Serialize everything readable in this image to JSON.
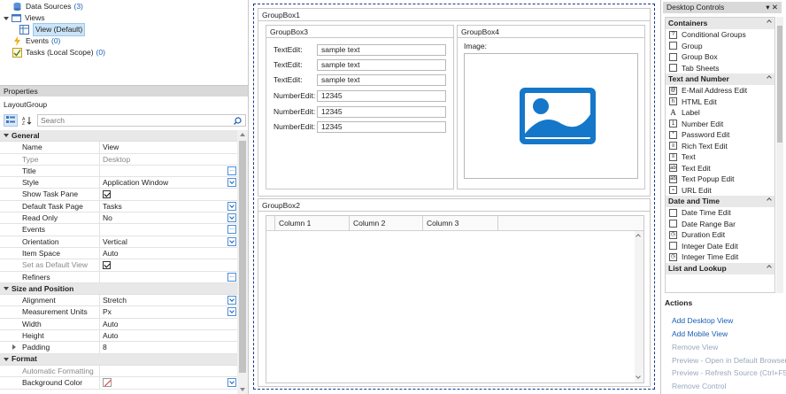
{
  "tree": {
    "items": [
      {
        "label": "Data Sources",
        "count": "(3)"
      },
      {
        "label": "Views",
        "count": ""
      },
      {
        "label": "View (Default)",
        "count": ""
      },
      {
        "label": "Events",
        "count": "(0)"
      },
      {
        "label": "Tasks (Local Scope)",
        "count": "(0)"
      }
    ]
  },
  "properties": {
    "header": "Properties",
    "selected_object": "LayoutGroup",
    "search_placeholder": "Search",
    "categories": {
      "general": "General",
      "size_position": "Size and Position",
      "format": "Format"
    },
    "rows": {
      "name": {
        "label": "Name",
        "value": "View"
      },
      "type": {
        "label": "Type",
        "value": "Desktop"
      },
      "title": {
        "label": "Title",
        "value": ""
      },
      "style": {
        "label": "Style",
        "value": "Application Window"
      },
      "show_task_pane": {
        "label": "Show Task Pane"
      },
      "default_task_page": {
        "label": "Default Task Page",
        "value": "Tasks"
      },
      "read_only": {
        "label": "Read Only",
        "value": "No"
      },
      "events": {
        "label": "Events",
        "value": ""
      },
      "orientation": {
        "label": "Orientation",
        "value": "Vertical"
      },
      "item_space": {
        "label": "Item Space",
        "value": "Auto"
      },
      "set_as_default_view": {
        "label": "Set as Default View"
      },
      "refiners": {
        "label": "Refiners",
        "value": ""
      },
      "alignment": {
        "label": "Alignment",
        "value": "Stretch"
      },
      "measurement_units": {
        "label": "Measurement Units",
        "value": "Px"
      },
      "width": {
        "label": "Width",
        "value": "Auto"
      },
      "height": {
        "label": "Height",
        "value": "Auto"
      },
      "padding": {
        "label": "Padding",
        "value": "8"
      },
      "automatic_formatting": {
        "label": "Automatic Formatting",
        "value": ""
      },
      "background_color": {
        "label": "Background Color"
      }
    }
  },
  "designer": {
    "groupbox1": "GroupBox1",
    "groupbox2": "GroupBox2",
    "groupbox3": "GroupBox3",
    "groupbox4": "GroupBox4",
    "fields": [
      {
        "label": "TextEdit:",
        "value": "sample text"
      },
      {
        "label": "TextEdit:",
        "value": "sample text"
      },
      {
        "label": "TextEdit:",
        "value": "sample text"
      },
      {
        "label": "NumberEdit:",
        "value": "12345"
      },
      {
        "label": "NumberEdit:",
        "value": "12345"
      },
      {
        "label": "NumberEdit:",
        "value": "12345"
      }
    ],
    "image_label": "Image:",
    "columns": [
      "Column 1",
      "Column 2",
      "Column 3"
    ]
  },
  "desktop_controls": {
    "header": "Desktop Controls",
    "header_icons": "▾ ✕",
    "cats": {
      "containers": "Containers",
      "text_number": "Text and Number",
      "date_time": "Date and Time",
      "list_lookup": "List and Lookup"
    },
    "containers": [
      "Conditional Groups",
      "Group",
      "Group Box",
      "Tab Sheets"
    ],
    "text_number": [
      "E-Mail Address Edit",
      "HTML Edit",
      "Label",
      "Number Edit",
      "Password Edit",
      "Rich Text Edit",
      "Text",
      "Text Edit",
      "Text Popup Edit",
      "URL Edit"
    ],
    "date_time": [
      "Date Time Edit",
      "Date Range Bar",
      "Duration Edit",
      "Integer Date Edit",
      "Integer Time Edit"
    ]
  },
  "actions": {
    "title": "Actions",
    "items": [
      {
        "label": "Add Desktop View",
        "enabled": true
      },
      {
        "label": "Add Mobile View",
        "enabled": true
      },
      {
        "label": "Remove View",
        "enabled": false
      },
      {
        "label": "Preview - Open in Default Browser",
        "enabled": false
      },
      {
        "label": "Preview - Refresh Source (Ctrl+F5)",
        "enabled": false
      },
      {
        "label": "Remove Control",
        "enabled": false
      }
    ]
  },
  "colors": {
    "accent": "#1a5fb4",
    "image_icon": "#1577c9"
  }
}
